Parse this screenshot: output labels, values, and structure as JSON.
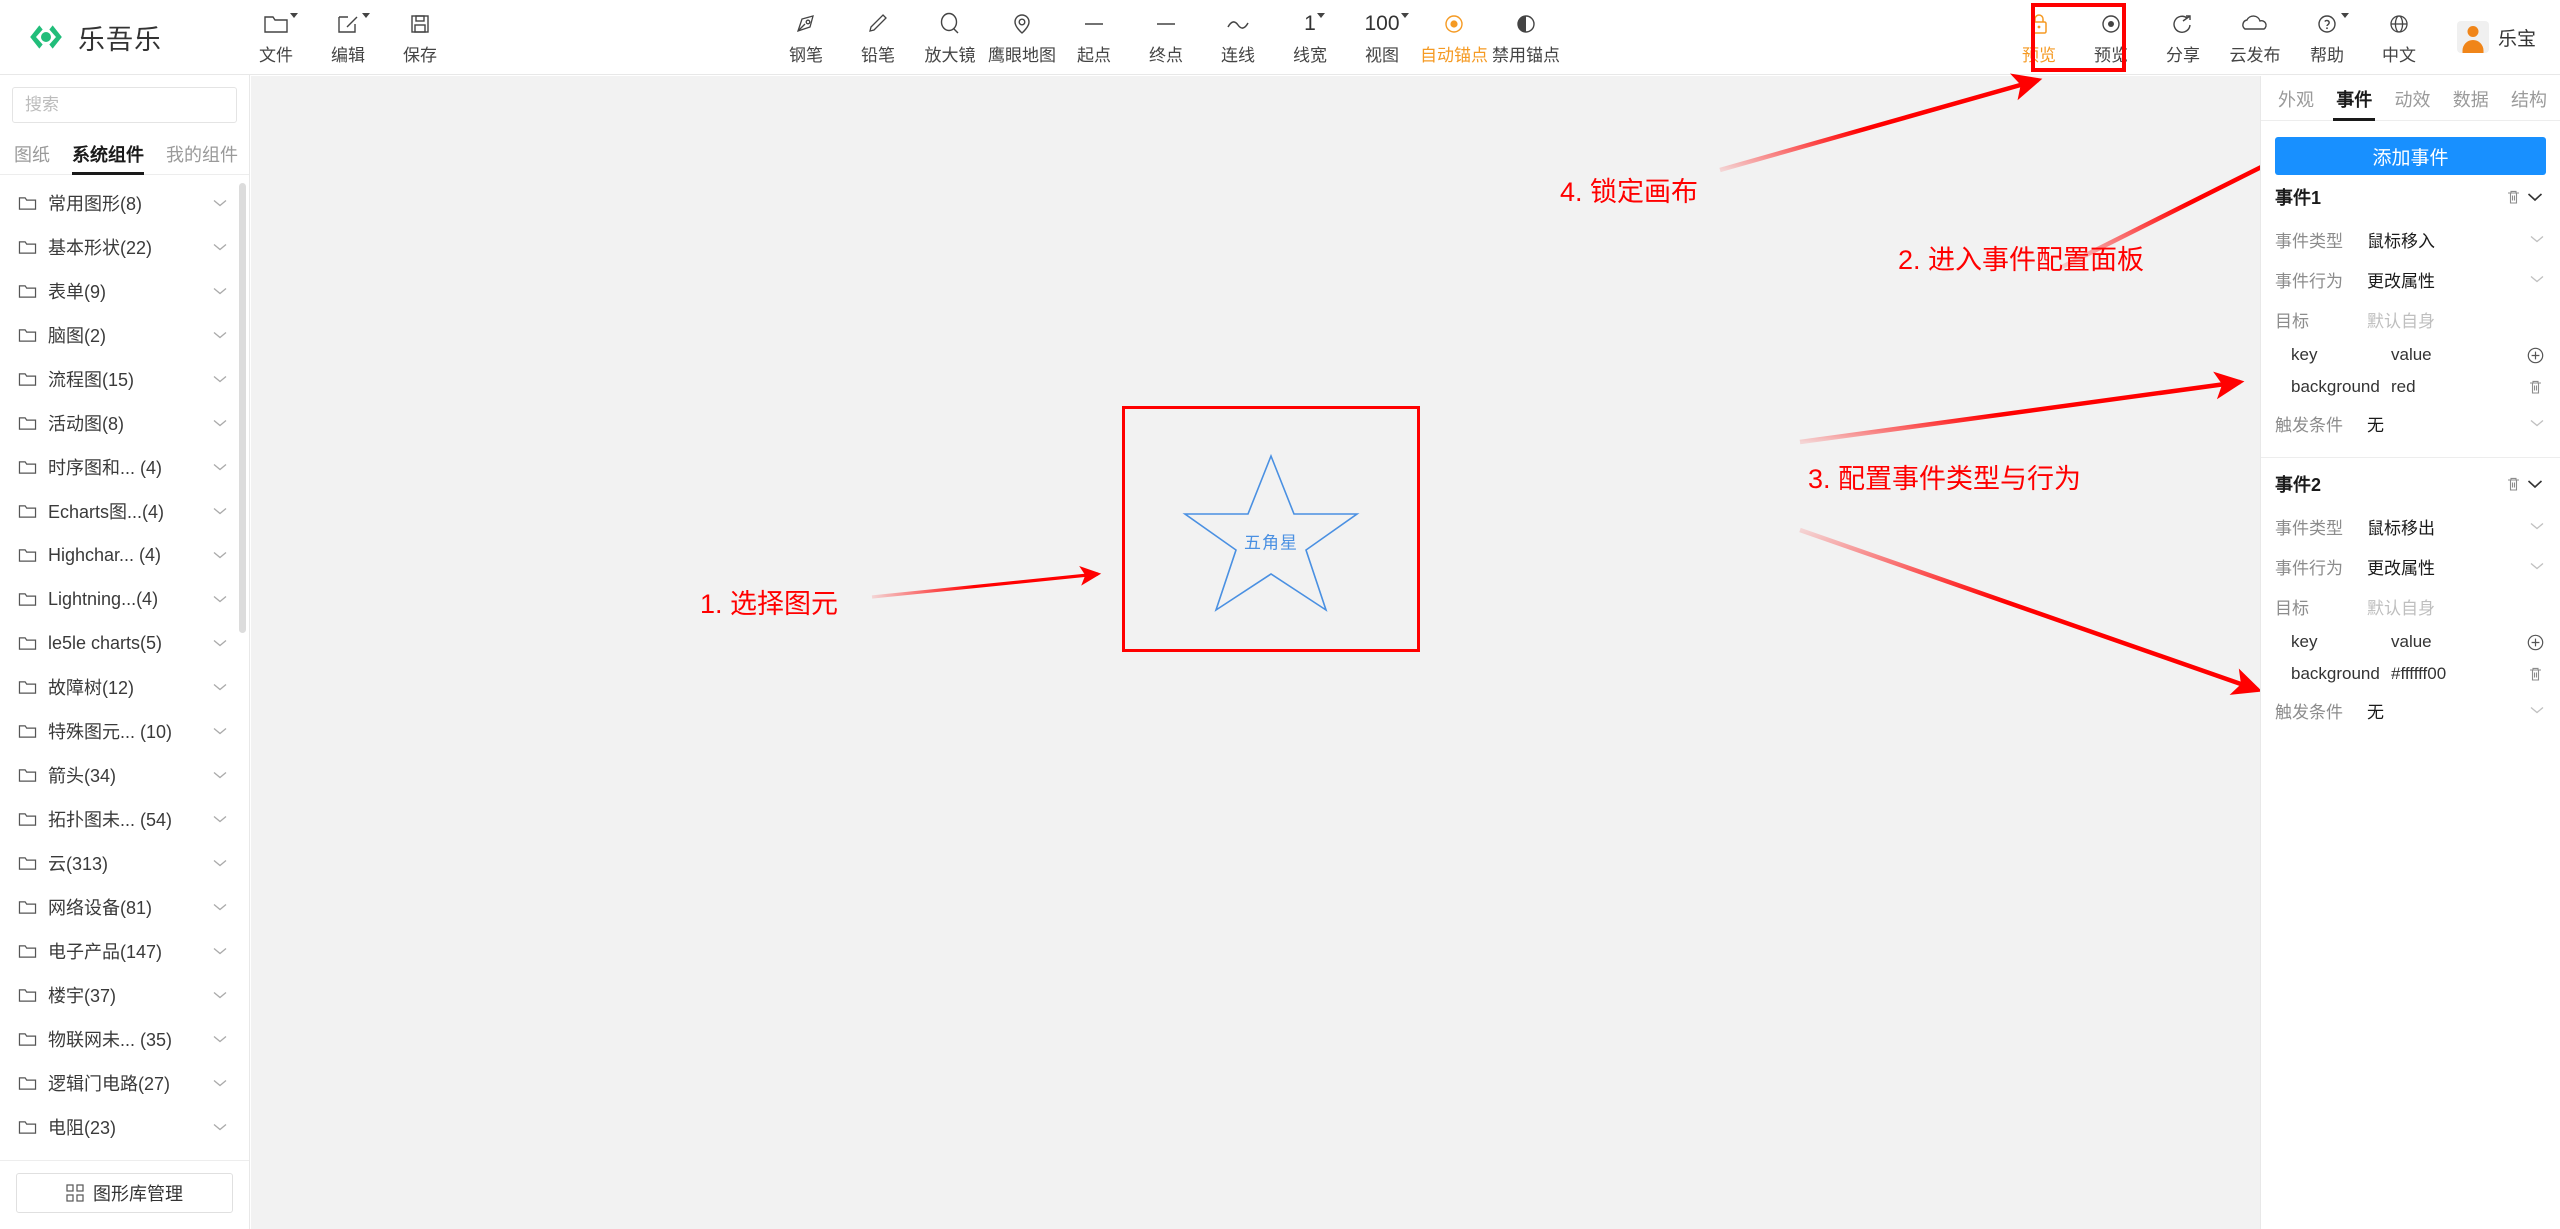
{
  "app": {
    "brand_name": "乐吾乐",
    "logo_color": "#21bd7a"
  },
  "toolbar": {
    "file_group": [
      {
        "label": "文件",
        "icon": "folder-icon",
        "has_caret": true
      },
      {
        "label": "编辑",
        "icon": "edit-square-icon",
        "has_caret": true
      },
      {
        "label": "保存",
        "icon": "save-disk-icon",
        "has_caret": false
      }
    ],
    "center_group": [
      {
        "label": "钢笔",
        "icon": "pen-nib-icon",
        "has_caret": false,
        "active": false
      },
      {
        "label": "铅笔",
        "icon": "pencil-icon",
        "has_caret": false,
        "active": false
      },
      {
        "label": "放大镜",
        "icon": "magnifier-icon",
        "has_caret": false,
        "active": false
      },
      {
        "label": "鹰眼地图",
        "icon": "eagle-eye-map-icon",
        "has_caret": false,
        "active": false
      },
      {
        "label": "起点",
        "icon": "line-start-icon",
        "has_caret": false,
        "active": false
      },
      {
        "label": "终点",
        "icon": "line-end-icon",
        "has_caret": false,
        "active": false
      },
      {
        "label": "连线",
        "icon": "curve-line-icon",
        "has_caret": false,
        "active": false
      },
      {
        "label": "线宽",
        "icon": "line-width-value",
        "value": "1",
        "has_caret": true,
        "active": false
      },
      {
        "label": "视图",
        "icon": "zoom-value",
        "value": "100",
        "has_caret": true,
        "active": false
      },
      {
        "label": "自动锚点",
        "icon": "auto-anchor-icon",
        "has_caret": false,
        "active": true
      },
      {
        "label": "禁用锚点",
        "icon": "disable-anchor-icon",
        "has_caret": false,
        "active": false
      }
    ],
    "right_group": [
      {
        "label": "预览",
        "icon": "lock-icon",
        "has_caret": false,
        "active": true,
        "highlighted": true
      },
      {
        "label": "预览",
        "icon": "eye-preview-icon",
        "has_caret": false,
        "active": false
      },
      {
        "label": "分享",
        "icon": "share-icon",
        "has_caret": false,
        "active": false
      },
      {
        "label": "云发布",
        "icon": "cloud-publish-icon",
        "has_caret": false,
        "active": false
      },
      {
        "label": "帮助",
        "icon": "help-circle-icon",
        "has_caret": true,
        "active": false
      },
      {
        "label": "中文",
        "icon": "globe-language-icon",
        "has_caret": false,
        "active": false
      }
    ],
    "user": {
      "name": "乐宝",
      "avatar": "user-avatar"
    }
  },
  "sidebar": {
    "search": {
      "placeholder": "搜索",
      "value": ""
    },
    "tabs": [
      {
        "label": "图纸",
        "active": false
      },
      {
        "label": "系统组件",
        "active": true
      },
      {
        "label": "我的组件",
        "active": false
      }
    ],
    "categories": [
      {
        "label": "常用图形(8)"
      },
      {
        "label": "基本形状(22)"
      },
      {
        "label": "表单(9)"
      },
      {
        "label": "脑图(2)"
      },
      {
        "label": "流程图(15)"
      },
      {
        "label": "活动图(8)"
      },
      {
        "label": "时序图和... (4)"
      },
      {
        "label": "Echarts图...(4)"
      },
      {
        "label": "Highchar... (4)"
      },
      {
        "label": "Lightning...(4)"
      },
      {
        "label": "le5le charts(5)"
      },
      {
        "label": "故障树(12)"
      },
      {
        "label": "特殊图元... (10)"
      },
      {
        "label": "箭头(34)"
      },
      {
        "label": "拓扑图未... (54)"
      },
      {
        "label": "云(313)"
      },
      {
        "label": "网络设备(81)"
      },
      {
        "label": "电子产品(147)"
      },
      {
        "label": "楼宇(37)"
      },
      {
        "label": "物联网未... (35)"
      },
      {
        "label": "逻辑门电路(27)"
      },
      {
        "label": "电阻(23)"
      }
    ],
    "footer_button": {
      "label": "图形库管理",
      "icon": "grid-blocks-icon"
    }
  },
  "canvas": {
    "shape": {
      "name": "五角星",
      "stroke_color": "#4a90e2",
      "selection_color": "#ff0000"
    }
  },
  "annotations": [
    {
      "id": "1",
      "text": "1. 选择图元"
    },
    {
      "id": "2",
      "text": "2. 进入事件配置面板"
    },
    {
      "id": "3",
      "text": "3. 配置事件类型与行为"
    },
    {
      "id": "4",
      "text": "4. 锁定画布"
    }
  ],
  "right_panel": {
    "tabs": [
      {
        "label": "外观",
        "active": false
      },
      {
        "label": "事件",
        "active": true
      },
      {
        "label": "动效",
        "active": false
      },
      {
        "label": "数据",
        "active": false
      },
      {
        "label": "结构",
        "active": false
      }
    ],
    "add_event_button": "添加事件",
    "events": [
      {
        "title": "事件1",
        "labels": {
          "type": "事件类型",
          "action": "事件行为",
          "target": "目标",
          "trigger": "触发条件"
        },
        "type_value": "鼠标移入",
        "action_value": "更改属性",
        "target_value": "默认自身",
        "kv_header": {
          "key": "key",
          "value": "value"
        },
        "kv_rows": [
          {
            "key": "background",
            "value": "red"
          }
        ],
        "trigger_value": "无"
      },
      {
        "title": "事件2",
        "labels": {
          "type": "事件类型",
          "action": "事件行为",
          "target": "目标",
          "trigger": "触发条件"
        },
        "type_value": "鼠标移出",
        "action_value": "更改属性",
        "target_value": "默认自身",
        "kv_header": {
          "key": "key",
          "value": "value"
        },
        "kv_rows": [
          {
            "key": "background",
            "value": "#ffffff00"
          }
        ],
        "trigger_value": "无"
      }
    ]
  },
  "colors": {
    "accent_orange": "#f59a23",
    "primary_blue": "#1890ff",
    "annotation_red": "#ff0000",
    "shape_blue": "#4a90e2",
    "canvas_bg": "#f2f2f2"
  }
}
